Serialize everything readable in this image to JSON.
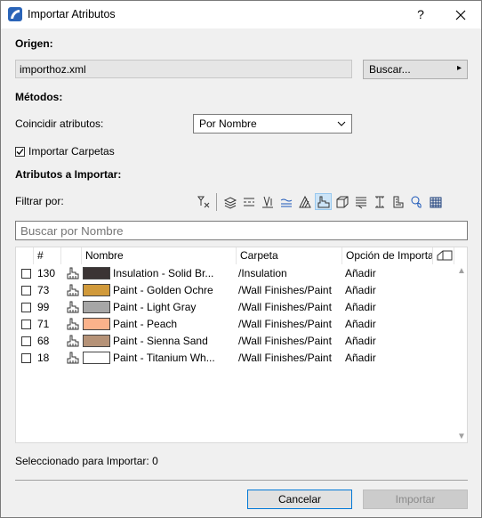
{
  "window": {
    "title": "Importar Atributos",
    "help": "?",
    "close": "✕"
  },
  "origen": {
    "heading": "Origen:",
    "file": "importhoz.xml",
    "browse": "Buscar...",
    "browse_arrow": "▸"
  },
  "metodos": {
    "heading": "Métodos:",
    "match_label": "Coincidir atributos:",
    "match_value": "Por Nombre",
    "import_folders": "Importar Carpetas"
  },
  "atributos": {
    "heading": "Atributos a Importar:",
    "filter_label": "Filtrar por:",
    "search_placeholder": "Buscar por Nombre"
  },
  "filter_icons": [
    "filter-clear-icon",
    "layers-icon",
    "line-types-icon",
    "pens-icon",
    "fill-types-icon",
    "composites-icon",
    "surfaces-icon",
    "profiles-icon",
    "building-materials-icon",
    "zones-icon",
    "mep-icon",
    "markup-icon",
    "operation-profiles-icon"
  ],
  "table": {
    "headers": {
      "num": "#",
      "name": "Nombre",
      "folder": "Carpeta",
      "option": "Opción de Importa"
    },
    "rows": [
      {
        "num": "130",
        "name": "Insulation - Solid Br...",
        "folder": "/Insulation",
        "option": "Añadir",
        "color": "#3b3434"
      },
      {
        "num": "73",
        "name": "Paint - Golden Ochre",
        "folder": "/Wall Finishes/Paint",
        "option": "Añadir",
        "color": "#d19a3b"
      },
      {
        "num": "99",
        "name": "Paint - Light Gray",
        "folder": "/Wall Finishes/Paint",
        "option": "Añadir",
        "color": "#a6a6a6"
      },
      {
        "num": "71",
        "name": "Paint - Peach",
        "folder": "/Wall Finishes/Paint",
        "option": "Añadir",
        "color": "#fbb28b"
      },
      {
        "num": "68",
        "name": "Paint - Sienna Sand",
        "folder": "/Wall Finishes/Paint",
        "option": "Añadir",
        "color": "#b59277"
      },
      {
        "num": "18",
        "name": "Paint - Titanium Wh...",
        "folder": "/Wall Finishes/Paint",
        "option": "Añadir",
        "color": "#ffffff"
      }
    ]
  },
  "status": "Seleccionado para Importar: 0",
  "buttons": {
    "cancel": "Cancelar",
    "import": "Importar"
  }
}
